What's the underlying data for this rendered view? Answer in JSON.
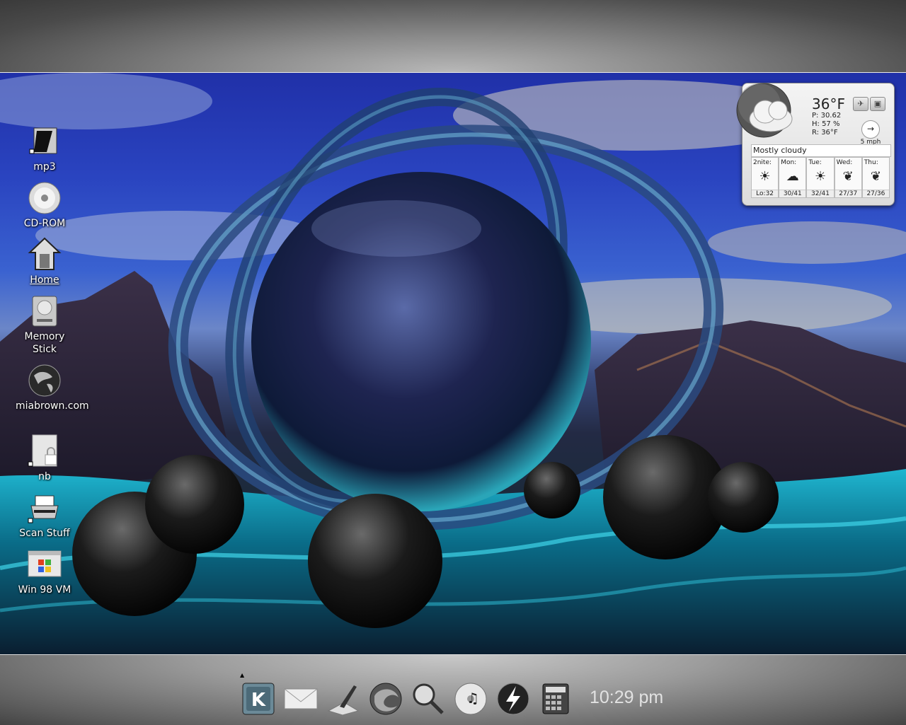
{
  "desktop": {
    "icons": [
      {
        "label": "mp3",
        "icon": "music-folder-icon"
      },
      {
        "label": "CD-ROM",
        "icon": "cd-rom-icon"
      },
      {
        "label": "Home",
        "icon": "home-icon"
      },
      {
        "label": "Memory Stick",
        "icon": "memory-stick-icon"
      },
      {
        "label": "miabrown.com",
        "icon": "globe-icon"
      },
      {
        "label": "nb",
        "icon": "locked-file-icon"
      },
      {
        "label": "Scan Stuff",
        "icon": "scanner-icon"
      },
      {
        "label": "Win 98 VM",
        "icon": "windows-vm-icon"
      }
    ]
  },
  "weather": {
    "temperature": "36°F",
    "pressure": "P:  30.62",
    "humidity": "H:  57 %",
    "realfeel": "R:  36°F",
    "wind": "5 mph",
    "condition": "Mostly cloudy",
    "forecast": [
      {
        "day": "2nite:",
        "temps": "Lo:32",
        "icon": "partly-cloudy-night-icon"
      },
      {
        "day": "Mon:",
        "temps": "30/41",
        "icon": "storm-icon"
      },
      {
        "day": "Tue:",
        "temps": "32/41",
        "icon": "partly-sunny-icon"
      },
      {
        "day": "Wed:",
        "temps": "27/37",
        "icon": "windy-icon"
      },
      {
        "day": "Thu:",
        "temps": "27/36",
        "icon": "windy-icon"
      }
    ]
  },
  "taskbar": {
    "items": [
      {
        "name": "kde-menu-button",
        "icon": "kde-k-icon"
      },
      {
        "name": "mail-button",
        "icon": "envelope-icon"
      },
      {
        "name": "editor-button",
        "icon": "brush-icon"
      },
      {
        "name": "browser-button",
        "icon": "firefox-icon"
      },
      {
        "name": "search-button",
        "icon": "magnifier-icon"
      },
      {
        "name": "music-button",
        "icon": "music-cd-icon"
      },
      {
        "name": "quick-launch-button",
        "icon": "lightning-icon"
      },
      {
        "name": "calculator-button",
        "icon": "calculator-icon"
      }
    ],
    "clock": "10:29 pm"
  },
  "colors": {
    "sky": "#2a44c0",
    "water": "#0d7f95",
    "panel": "#9c9c9c"
  }
}
